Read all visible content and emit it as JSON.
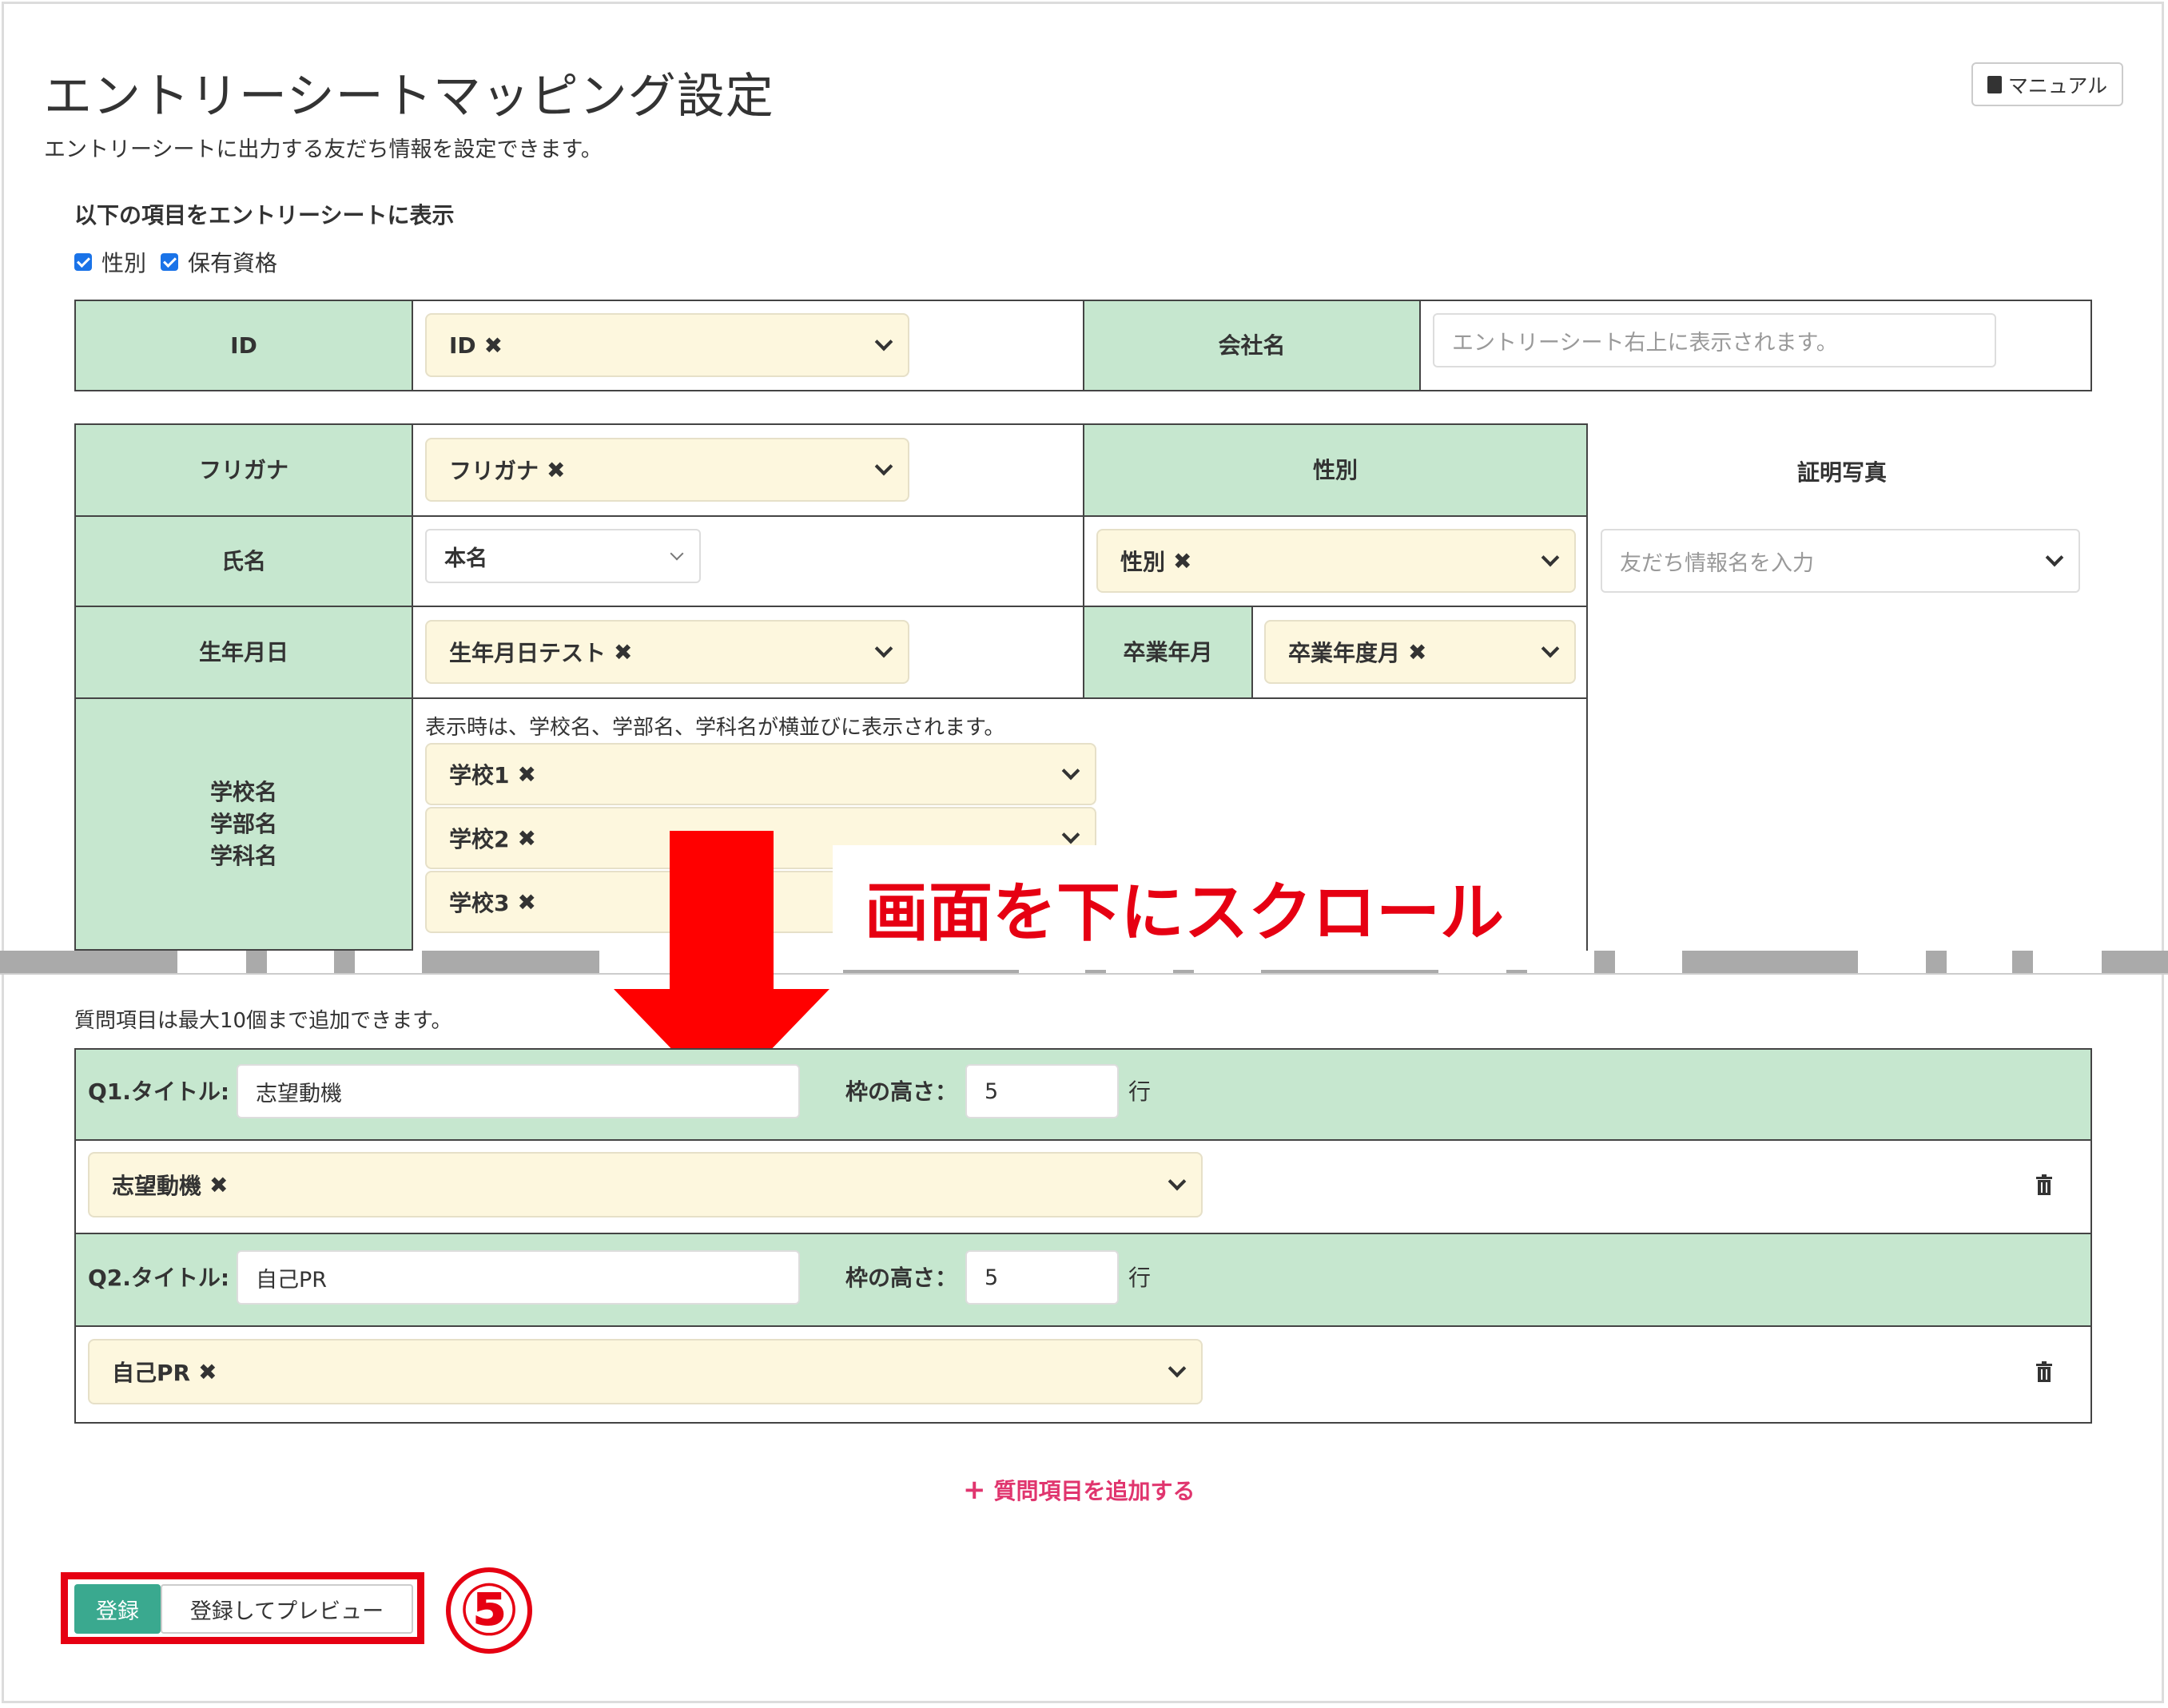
{
  "page": {
    "title": "エントリーシートマッピング設定",
    "subtitle": "エントリーシートに出力する友だち情報を設定できます。",
    "manual_label": "マニュアル"
  },
  "display_section": {
    "label": "以下の項目をエントリーシートに表示",
    "checkboxes": [
      {
        "label": "性別",
        "checked": true
      },
      {
        "label": "保有資格",
        "checked": true
      }
    ]
  },
  "mapping": {
    "id_label": "ID",
    "id_value": "ID",
    "company_label": "会社名",
    "company_placeholder": "エントリーシート右上に表示されます。",
    "furigana_label": "フリガナ",
    "furigana_value": "フリガナ",
    "gender_label": "性別",
    "photo_label": "証明写真",
    "name_label": "氏名",
    "name_value": "本名",
    "gender_value": "性別",
    "photo_placeholder": "友だち情報名を入力",
    "birth_label": "生年月日",
    "birth_value": "生年月日テスト",
    "grad_label": "卒業年月",
    "grad_value": "卒業年度月",
    "school_label_1": "学校名",
    "school_label_2": "学部名",
    "school_label_3": "学科名",
    "school_note": "表示時は、学校名、学部名、学科名が横並びに表示されます。",
    "school_values": [
      "学校1",
      "学校2",
      "学校3"
    ]
  },
  "annotation": {
    "scroll_text": "画面を下にスクロール",
    "step_number": "⑤"
  },
  "questions": {
    "note": "質問項目は最大10個まで追加できます。",
    "items": [
      {
        "label": "Q1.タイトル:",
        "title": "志望動機",
        "height_label": "枠の高さ：",
        "height": "5",
        "unit": "行",
        "mapping": "志望動機"
      },
      {
        "label": "Q2.タイトル:",
        "title": "自己PR",
        "height_label": "枠の高さ：",
        "height": "5",
        "unit": "行",
        "mapping": "自己PR"
      }
    ],
    "add_label": "質問項目を追加する"
  },
  "actions": {
    "register": "登録",
    "register_preview": "登録してプレビュー"
  },
  "colors": {
    "label_bg": "#c6e7cf",
    "select_bg": "#fdf7de",
    "accent_red": "#e60012",
    "primary_btn": "#3aa98f",
    "link_pink": "#e0356e"
  }
}
